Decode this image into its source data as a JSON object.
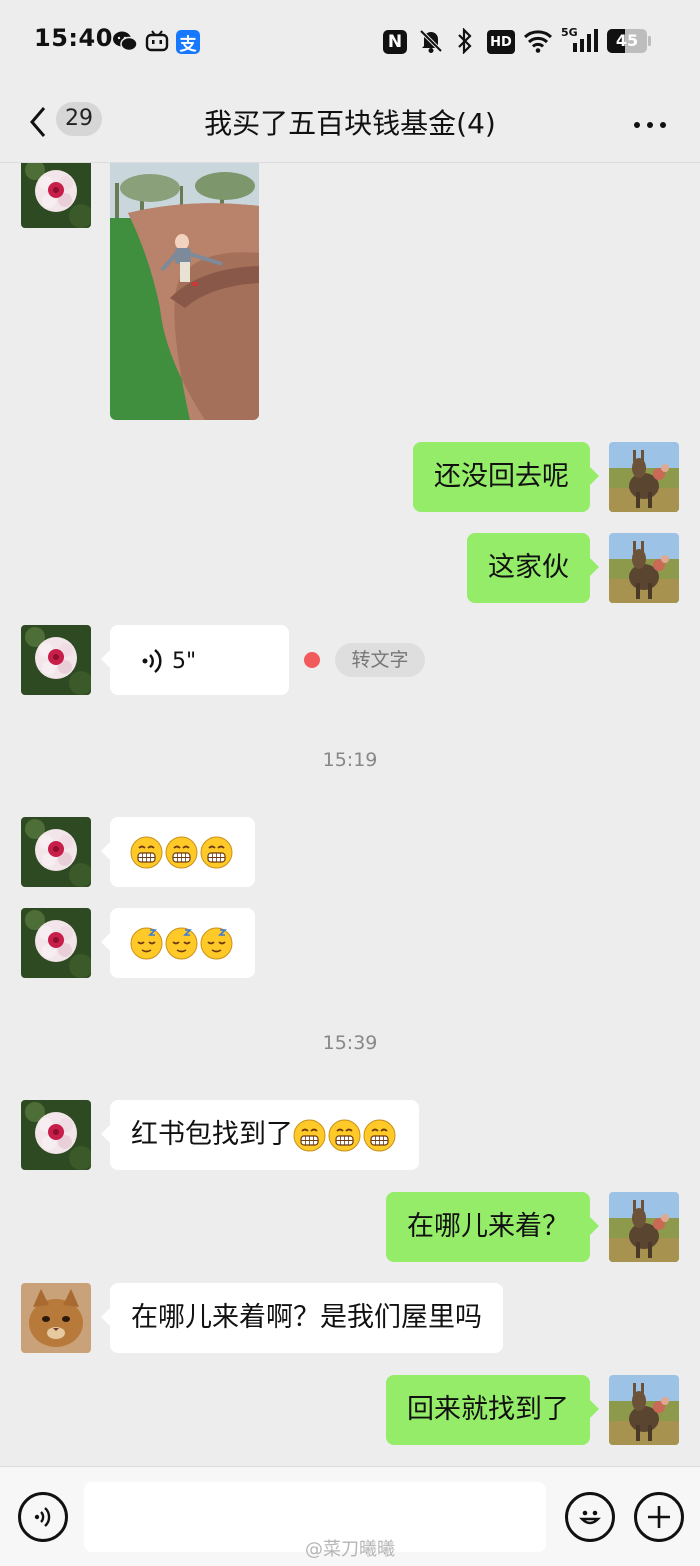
{
  "status_bar": {
    "time": "15:40",
    "battery": "45",
    "network": "5G",
    "hd": "HD",
    "nfc": "N",
    "alipay": "支",
    "icons": [
      "wechat-icon",
      "bilibili-icon",
      "alipay-icon",
      "nfc-icon",
      "mute-bell-icon",
      "bluetooth-icon",
      "hd-icon",
      "wifi-icon",
      "signal-icon",
      "battery-icon"
    ]
  },
  "header": {
    "unread_count": "29",
    "title": "我买了五百块钱基金(4)",
    "back_icon": "back-chevron-icon",
    "more_icon": "more-dots-icon"
  },
  "messages": {
    "m_image": {
      "kind": "image",
      "side": "left",
      "sender_avatar": "flower"
    },
    "m1": {
      "text": "还没回去呢",
      "side": "right"
    },
    "m2": {
      "text": "这家伙",
      "side": "right"
    },
    "m_voice": {
      "duration": "5\"",
      "transcribe_label": "转文字",
      "side": "left"
    },
    "time1": "15:19",
    "m_emoji1": {
      "emojis": [
        "grin",
        "grin",
        "grin"
      ],
      "side": "left"
    },
    "m_emoji2": {
      "emojis": [
        "sleepy",
        "sleepy",
        "sleepy"
      ],
      "side": "left"
    },
    "time2": "15:39",
    "m3": {
      "text": "红书包找到了",
      "emojis": [
        "grin",
        "grin",
        "grin"
      ],
      "side": "left"
    },
    "m4": {
      "text": "在哪儿来着？",
      "side": "right"
    },
    "m5": {
      "text": "在哪儿来着啊？是我们屋里吗",
      "side": "left",
      "sender_avatar": "cat"
    },
    "m6": {
      "text": "回来就找到了",
      "side": "right"
    }
  },
  "input_bar": {
    "voice_icon": "voice-input-icon",
    "emoji_icon": "emoji-icon",
    "plus_icon": "plus-icon",
    "input_value": ""
  },
  "watermark": "@菜刀曦曦",
  "colors": {
    "background": "#ededed",
    "outgoing_bubble": "#95ec69",
    "incoming_bubble": "#ffffff",
    "unread_dot": "#f15b5b",
    "alipay_blue": "#1677ff"
  }
}
